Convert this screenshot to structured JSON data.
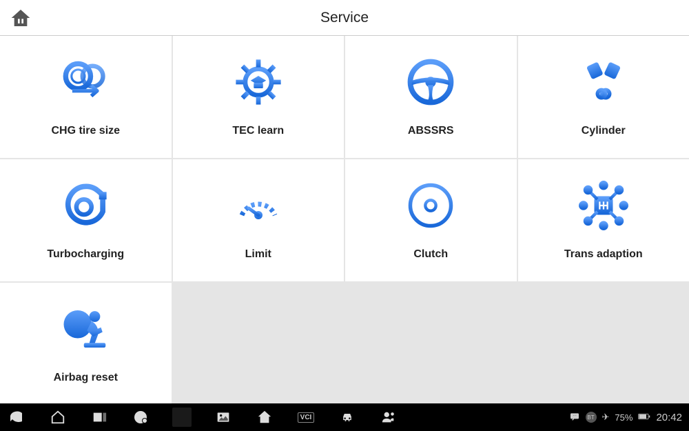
{
  "header": {
    "title": "Service"
  },
  "tiles": [
    {
      "id": "chg-tire-size",
      "label": "CHG tire size",
      "icon": "tire-size-icon"
    },
    {
      "id": "tec-learn",
      "label": "TEC learn",
      "icon": "gear-learn-icon"
    },
    {
      "id": "abssrs",
      "label": "ABSSRS",
      "icon": "steering-wheel-icon"
    },
    {
      "id": "cylinder",
      "label": "Cylinder",
      "icon": "pistons-icon"
    },
    {
      "id": "turbocharging",
      "label": "Turbocharging",
      "icon": "turbo-icon"
    },
    {
      "id": "limit",
      "label": "Limit",
      "icon": "gauge-icon"
    },
    {
      "id": "clutch",
      "label": "Clutch",
      "icon": "clutch-icon"
    },
    {
      "id": "trans-adaption",
      "label": "Trans adaption",
      "icon": "transmission-icon"
    },
    {
      "id": "airbag-reset",
      "label": "Airbag reset",
      "icon": "airbag-icon"
    }
  ],
  "bottombar": {
    "vci": "VCI",
    "bt": "BT",
    "wifi": "75%",
    "time": "20:42"
  },
  "colors": {
    "brand_blue_light": "#5b9df9",
    "brand_blue_dark": "#1968d9"
  }
}
